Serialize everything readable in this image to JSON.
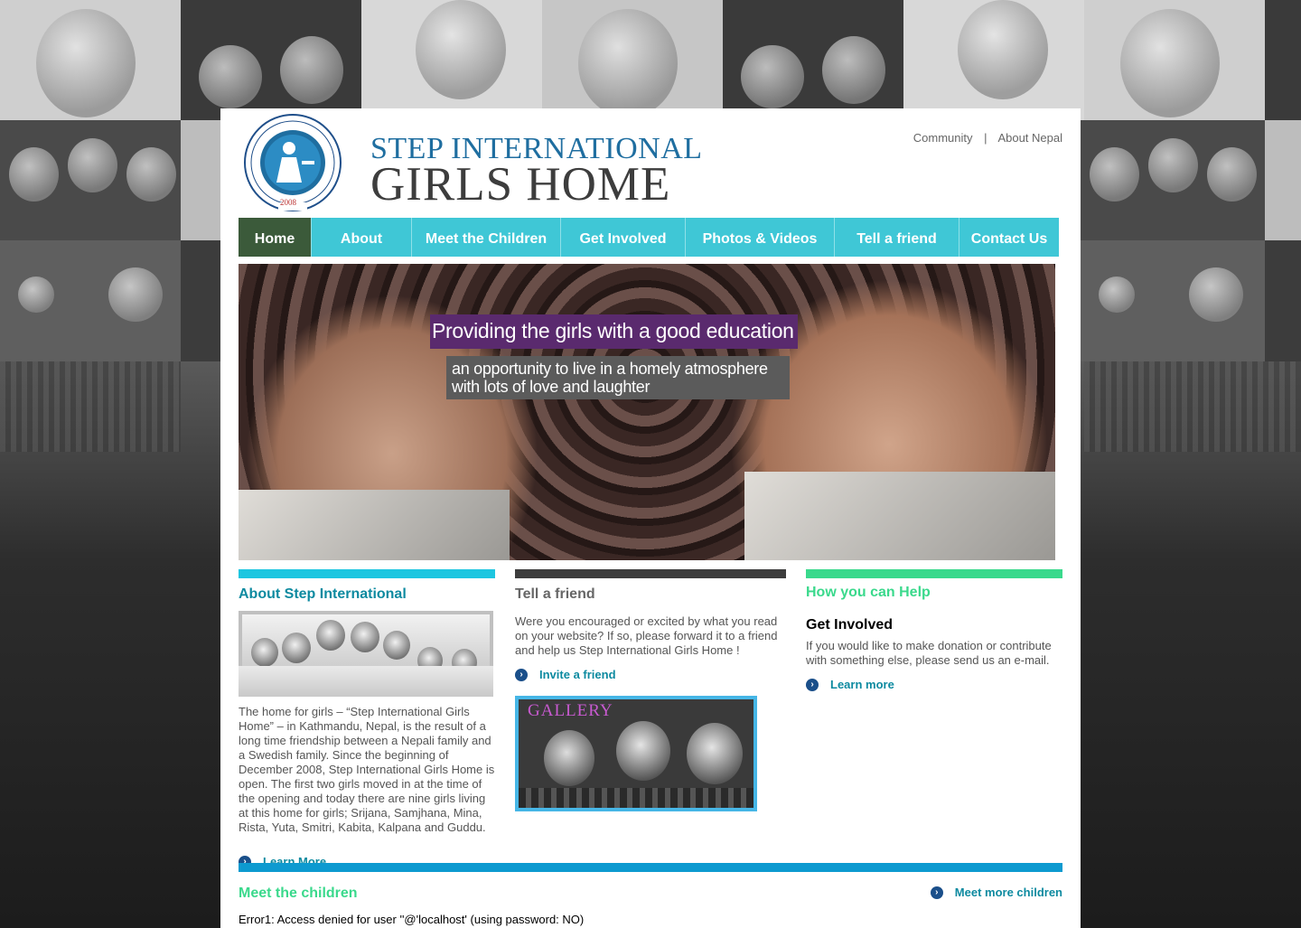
{
  "brand": {
    "line1": "STEP INTERNATIONAL",
    "line2": "GIRLS HOME",
    "seal_text": "STEP INTERNATIONAL GIRLS HOME",
    "seal_year": "2008"
  },
  "toplinks": {
    "community": "Community",
    "separator": "|",
    "about_nepal": "About Nepal"
  },
  "nav": [
    "Home",
    "About",
    "Meet the Children",
    "Get Involved",
    "Photos & Videos",
    "Tell a friend",
    "Contact Us"
  ],
  "hero": {
    "headline": "Providing the girls with a good education",
    "sub_line1": "an opportunity to live in a homely atmosphere",
    "sub_line2": "with lots of love and laughter"
  },
  "about": {
    "title": "About Step International",
    "text": "The home for girls – “Step International Girls Home” – in Kathmandu, Nepal, is the result of a long time friendship between a Nepali family and a Swedish family. Since the beginning of December 2008, Step International Girls Home is open. The first two girls moved in at the time of the opening and today there are nine girls living at this home for girls; Srijana, Samjhana, Mina, Rista, Yuta, Smitri, Kabita, Kalpana and Guddu.",
    "link": "Learn More"
  },
  "tell": {
    "title": "Tell a friend",
    "text": "Were you encouraged or excited by what you read on your website? If so, please forward it to a friend and help us Step International Girls Home !",
    "link": "Invite a friend",
    "gallery_label": "GALLERY"
  },
  "help": {
    "title": "How you can Help",
    "subtitle": "Get Involved",
    "text": "If you would like to make donation or contribute with something else, please send us an e-mail.",
    "link": "Learn more"
  },
  "children": {
    "title": "Meet the children",
    "link": "Meet more children"
  },
  "error": "Error1: Access denied for user ''@'localhost' (using password: NO)",
  "colors": {
    "nav_bg": "#3fc7d6",
    "nav_active": "#3b5a3a",
    "about_bar": "#1ec6e0",
    "tell_bar": "#3d3d3d",
    "help_bar": "#3ad98c",
    "children_bar": "#0d9ad0",
    "link": "#0d8aa0"
  }
}
